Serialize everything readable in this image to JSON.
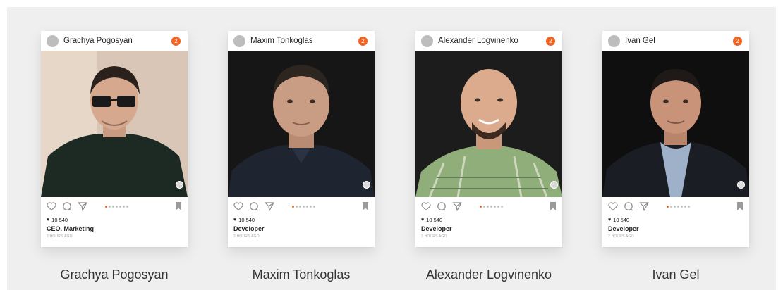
{
  "cards": [
    {
      "username": "Grachya Pogosyan",
      "notifications": "2",
      "likes": "10 540",
      "role": "CEO. Marketing",
      "time": "2 HOURS AGO",
      "caption": "Grachya Pogosyan"
    },
    {
      "username": "Maxim Tonkoglas",
      "notifications": "2",
      "likes": "10 540",
      "role": "Developer",
      "time": "2 HOURS AGO",
      "caption": "Maxim Tonkoglas"
    },
    {
      "username": "Alexander Logvinenko",
      "notifications": "2",
      "likes": "10 540",
      "role": "Developer",
      "time": "2 HOURS AGO",
      "caption": "Alexander Logvinenko"
    },
    {
      "username": "Ivan Gel",
      "notifications": "2",
      "likes": "10 540",
      "role": "Developer",
      "time": "2 HOURS AGO",
      "caption": "Ivan Gel"
    }
  ],
  "carousel": {
    "total": 7,
    "active": 0
  },
  "colors": {
    "accent": "#f26322",
    "background": "#efefef",
    "card": "#ffffff"
  },
  "icons": [
    "heart-icon",
    "comment-icon",
    "share-icon",
    "bookmark-icon",
    "user-badge-icon"
  ]
}
